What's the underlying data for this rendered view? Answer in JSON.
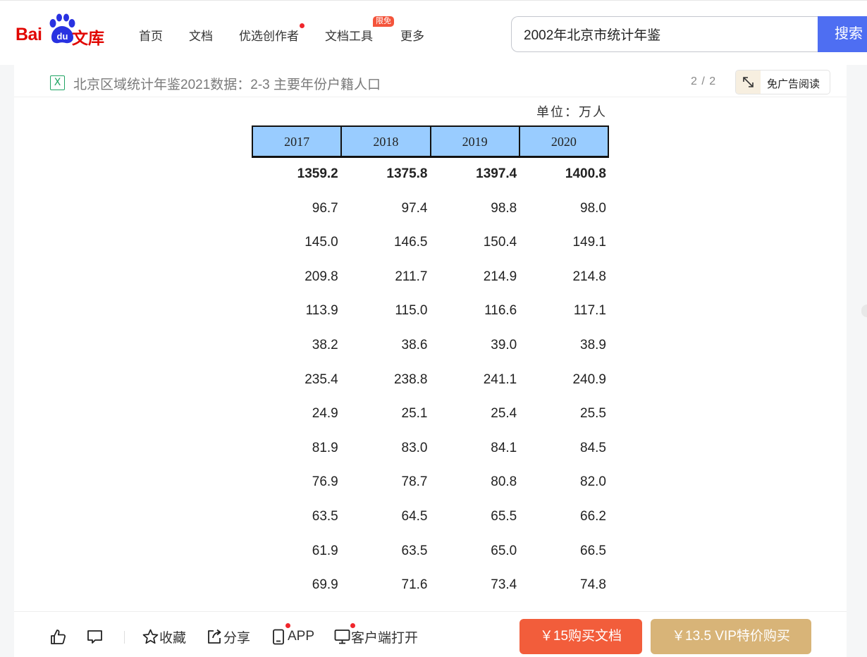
{
  "logo": {
    "bai": "Bai",
    "du": "du",
    "wenku": "文库"
  },
  "nav": {
    "items": [
      {
        "label": "首页"
      },
      {
        "label": "文档"
      },
      {
        "label": "优选创作者"
      },
      {
        "label": "文档工具",
        "badge": "限免"
      },
      {
        "label": "更多"
      }
    ]
  },
  "search": {
    "value": "2002年北京市统计年鉴",
    "button": "搜索"
  },
  "doc": {
    "file_icon": "X",
    "title": "北京区域统计年鉴2021数据：2-3 主要年份户籍人口",
    "page_count": "2 / 2",
    "adfree_label": "免广告阅读"
  },
  "table": {
    "unit": "单位：万人",
    "header_color": "#99ccff",
    "columns": [
      "2017",
      "2018",
      "2019",
      "2020"
    ],
    "rows": [
      [
        "1359.2",
        "1375.8",
        "1397.4",
        "1400.8"
      ],
      [
        "96.7",
        "97.4",
        "98.8",
        "98.0"
      ],
      [
        "145.0",
        "146.5",
        "150.4",
        "149.1"
      ],
      [
        "209.8",
        "211.7",
        "214.9",
        "214.8"
      ],
      [
        "113.9",
        "115.0",
        "116.6",
        "117.1"
      ],
      [
        "38.2",
        "38.6",
        "39.0",
        "38.9"
      ],
      [
        "235.4",
        "238.8",
        "241.1",
        "240.9"
      ],
      [
        "24.9",
        "25.1",
        "25.4",
        "25.5"
      ],
      [
        "81.9",
        "83.0",
        "84.1",
        "84.5"
      ],
      [
        "76.9",
        "78.7",
        "80.8",
        "82.0"
      ],
      [
        "63.5",
        "64.5",
        "65.5",
        "66.2"
      ],
      [
        "61.9",
        "63.5",
        "65.0",
        "66.5"
      ],
      [
        "69.9",
        "71.6",
        "73.4",
        "74.8"
      ]
    ]
  },
  "bottom": {
    "favorite": "收藏",
    "share": "分享",
    "app": "APP",
    "client": "客户端打开",
    "buy": "￥15购买文档",
    "vip": "￥13.5 VIP特价购买"
  },
  "colors": {
    "brand_red": "#e10601",
    "brand_blue": "#2932e1",
    "search_blue": "#4e6ef2",
    "buy_orange": "#f25d3b",
    "vip_gold": "#d8b478"
  }
}
